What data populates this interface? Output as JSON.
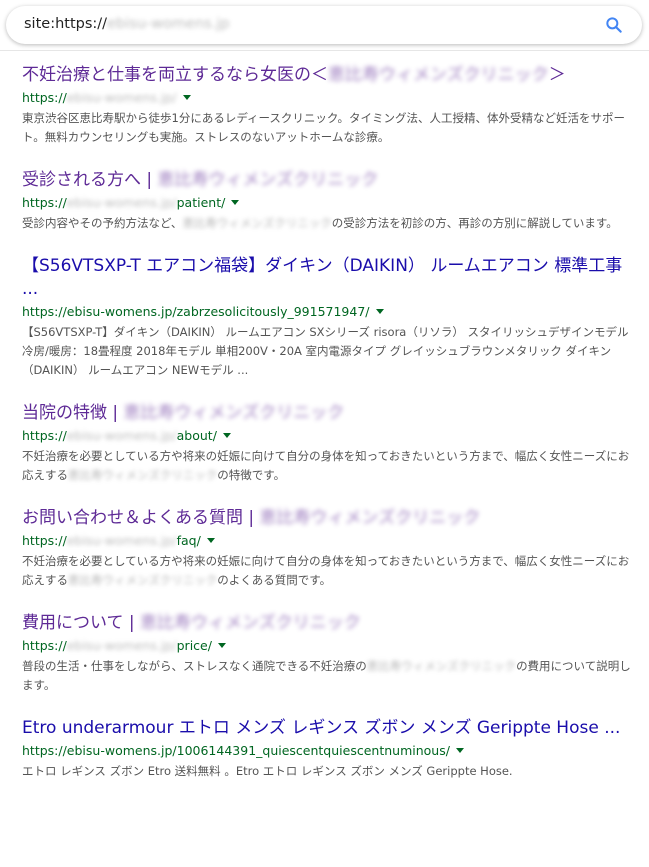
{
  "search": {
    "query_prefix": "site:https://",
    "query_blurred": "ebisu-womens.jp"
  },
  "results": [
    {
      "title_pre": "不妊治療と仕事を両立するなら女医の＜",
      "title_blur": "恵比寿ウィメンズクリニック",
      "title_post": "＞",
      "url_pre": "https://",
      "url_blur": "ebisu-womens.jp/",
      "url_post": "",
      "snippet_pre": "東京渋谷区恵比寿駅から徒歩1分にあるレディースクリニック。タイミング法、人工授精、体外受精など妊活をサポート。無料カウンセリングも実施。ストレスのないアットホームな診療。",
      "snippet_blur": "",
      "snippet_post": ""
    },
    {
      "title_pre": "受診される方へ | ",
      "title_blur": "恵比寿ウィメンズクリニック",
      "title_post": "",
      "url_pre": "https://",
      "url_blur": "ebisu-womens.jp/",
      "url_post": "patient/",
      "snippet_pre": "受診内容やその予約方法など、",
      "snippet_blur": "恵比寿ウィメンズクリニック",
      "snippet_post": "の受診方法を初診の方、再診の方別に解説しています。"
    },
    {
      "title_pre": "【S56VTSXP-T エアコン福袋】ダイキン（DAIKIN） ルームエアコン 標準工事 ...",
      "title_blur": "",
      "title_post": "",
      "url_pre": "https://ebisu-womens.jp/zabrzesolicitously_991571947/",
      "url_blur": "",
      "url_post": "",
      "snippet_pre": "【S56VTSXP-T】ダイキン（DAIKIN） ルームエアコン SXシリーズ risora（リソラ） スタイリッシュデザインモデル 冷房/暖房：18畳程度 2018年モデル 単相200V・20A 室内電源タイプ グレイッシュブラウンメタリック ダイキン（DAIKIN） ルームエアコン NEWモデル ...",
      "snippet_blur": "",
      "snippet_post": "",
      "unvisited": true
    },
    {
      "title_pre": "当院の特徴 | ",
      "title_blur": "恵比寿ウィメンズクリニック",
      "title_post": "",
      "url_pre": "https://",
      "url_blur": "ebisu-womens.jp/",
      "url_post": "about/",
      "snippet_pre": "不妊治療を必要としている方や将来の妊娠に向けて自分の身体を知っておきたいという方まで、幅広く女性ニーズにお応えする",
      "snippet_blur": "恵比寿ウィメンズクリニック",
      "snippet_post": "の特徴です。"
    },
    {
      "title_pre": "お問い合わせ＆よくある質問 | ",
      "title_blur": "恵比寿ウィメンズクリニック",
      "title_post": "",
      "url_pre": "https://",
      "url_blur": "ebisu-womens.jp/",
      "url_post": "faq/",
      "snippet_pre": "不妊治療を必要としている方や将来の妊娠に向けて自分の身体を知っておきたいという方まで、幅広く女性ニーズにお応えする",
      "snippet_blur": "恵比寿ウィメンズクリニック",
      "snippet_post": "のよくある質問です。"
    },
    {
      "title_pre": "費用について | ",
      "title_blur": "恵比寿ウィメンズクリニック",
      "title_post": "",
      "url_pre": "https://",
      "url_blur": "ebisu-womens.jp/",
      "url_post": "price/",
      "snippet_pre": "普段の生活・仕事をしながら、ストレスなく通院できる不妊治療の",
      "snippet_blur": "恵比寿ウィメンズクリニック",
      "snippet_post": "の費用について説明します。"
    },
    {
      "title_pre": "Etro underarmour エトロ メンズ レギンス ズボン メンズ Gerippte Hose ...",
      "title_blur": "",
      "title_post": "",
      "url_pre": "https://ebisu-womens.jp/1006144391_quiescentquiescentnuminous/",
      "url_blur": "",
      "url_post": "",
      "snippet_pre": "エトロ レギンス ズボン Etro 送料無料 。Etro エトロ レギンス ズボン メンズ Gerippte Hose.",
      "snippet_blur": "",
      "snippet_post": "",
      "unvisited": true
    }
  ]
}
